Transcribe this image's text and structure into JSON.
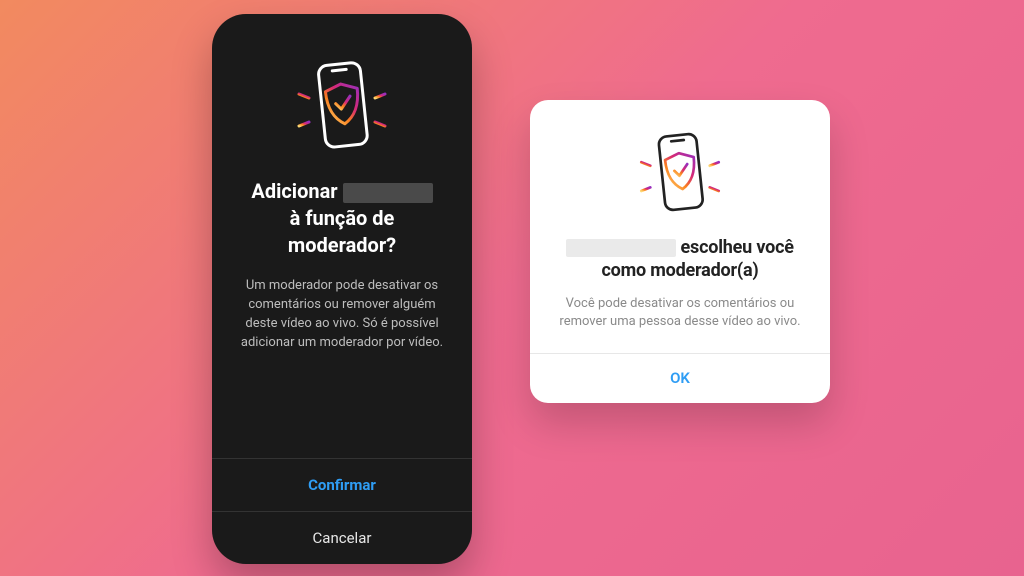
{
  "dark_modal": {
    "title_before": "Adicionar",
    "title_after": "à função de moderador?",
    "body": "Um moderador pode desativar os comentários ou remover alguém deste vídeo ao vivo. Só é possível adicionar um moderador por vídeo.",
    "confirm": "Confirmar",
    "cancel": "Cancelar"
  },
  "light_modal": {
    "title_after": "escolheu você como moderador(a)",
    "body": "Você pode desativar os comentários ou remover uma pessoa desse vídeo ao vivo.",
    "ok": "OK"
  },
  "colors": {
    "accent": "#2f9df4"
  }
}
